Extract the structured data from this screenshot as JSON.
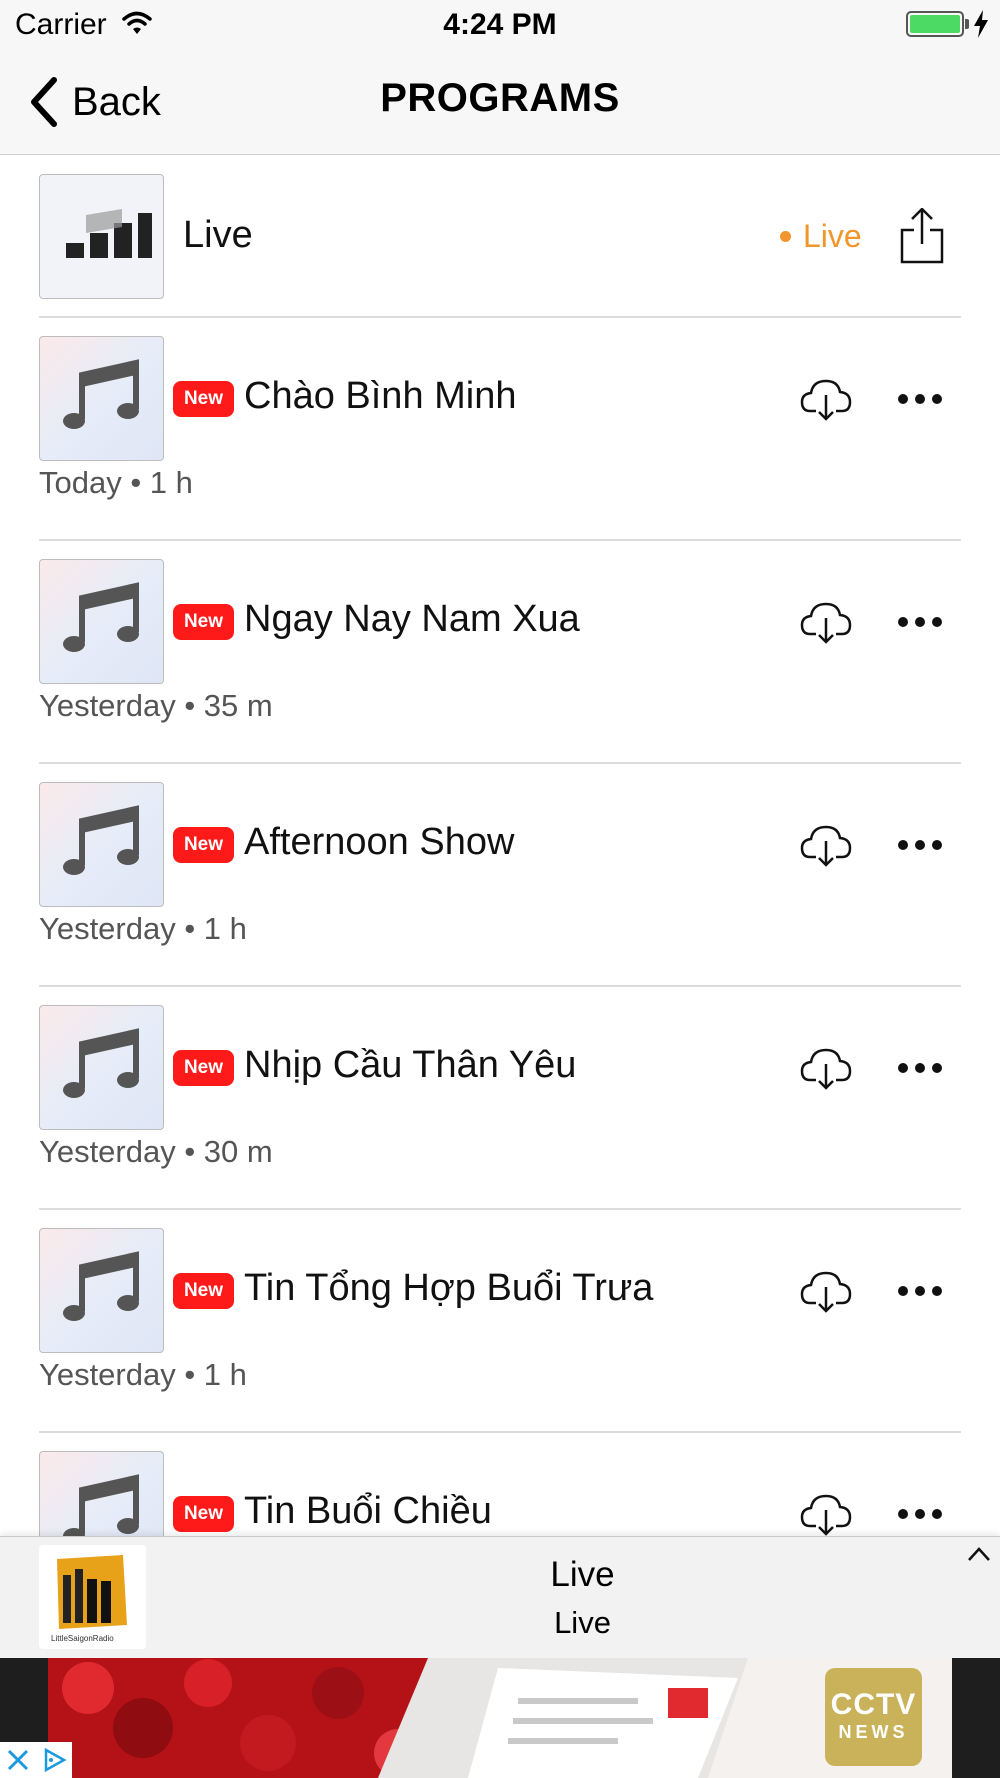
{
  "status_bar": {
    "carrier": "Carrier",
    "time": "4:24 PM",
    "battery_color": "#4cd964"
  },
  "nav": {
    "back_label": "Back",
    "title": "PROGRAMS"
  },
  "live_row": {
    "title": "Live",
    "status": "Live",
    "status_color": "#f0962a",
    "icon": "signal-bars-icon"
  },
  "episodes": [
    {
      "badge": "New",
      "title": "Chào Bình Minh",
      "meta": "Today • 1 h"
    },
    {
      "badge": "New",
      "title": "Ngay Nay Nam Xua",
      "meta": "Yesterday • 35 m"
    },
    {
      "badge": "New",
      "title": "Afternoon Show",
      "meta": "Yesterday • 1 h"
    },
    {
      "badge": "New",
      "title": "Nhịp Cầu Thân Yêu",
      "meta": "Yesterday • 30 m"
    },
    {
      "badge": "New",
      "title": "Tin Tổng Hợp Buổi Trưa",
      "meta": "Yesterday • 1 h"
    },
    {
      "badge": "New",
      "title": "Tin Buổi Chiều",
      "meta": ""
    }
  ],
  "mini_player": {
    "title": "Live",
    "subtitle": "Live",
    "station_logo_text": "LittleSaigonRadio"
  },
  "ad": {
    "logo_main": "CCTV",
    "logo_sub": "NEWS"
  },
  "colors": {
    "new_badge": "#ff1a1a",
    "live_accent": "#f0962a"
  }
}
